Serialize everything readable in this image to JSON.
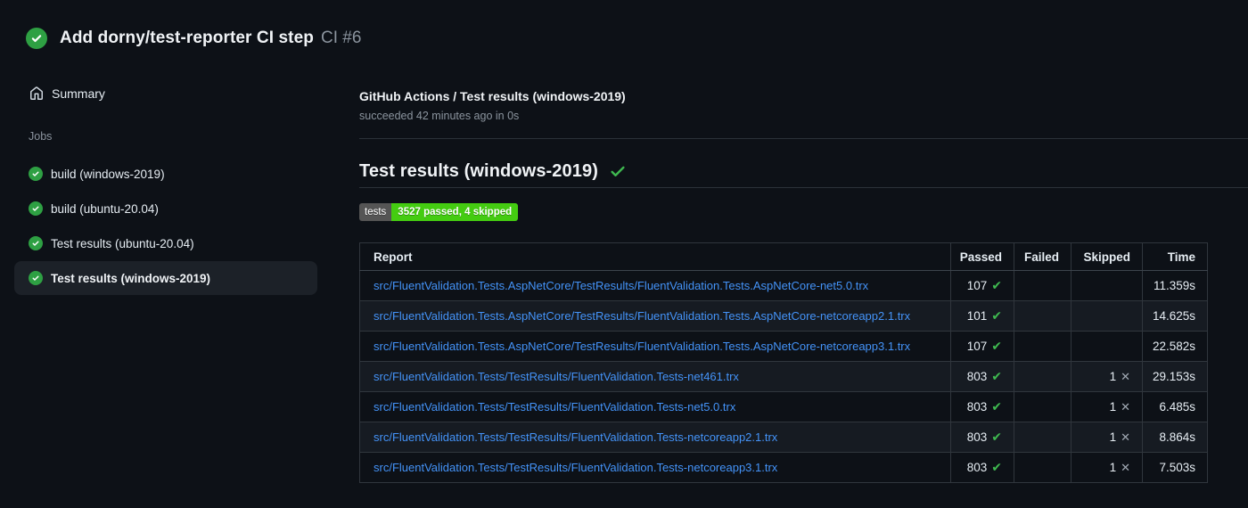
{
  "colors": {
    "page_bg": "#0d1117",
    "stripe_bg": "#161b22",
    "border": "#30363d",
    "selected_item_bg": "#1c2128",
    "link_blue": "#4493f8",
    "success_circle_green": "#2ea043",
    "check_green": "#3fb950",
    "badge_label_bg": "#555555",
    "badge_value_bg": "#44cc11",
    "muted_text": "#8b949e"
  },
  "icons": {
    "status_icon": "check-circle-green",
    "summary_icon": "home-outline",
    "heading_icon": "green-check",
    "pass_glyph": "✔",
    "skip_glyph": "✕"
  },
  "header": {
    "title": "Add dorny/test-reporter CI step",
    "run_number": "CI #6"
  },
  "sidebar": {
    "summary_label": "Summary",
    "jobs_label": "Jobs",
    "jobs": [
      {
        "label": "build (windows-2019)",
        "status": "success",
        "selected": false
      },
      {
        "label": "build (ubuntu-20.04)",
        "status": "success",
        "selected": false
      },
      {
        "label": "Test results (ubuntu-20.04)",
        "status": "success",
        "selected": false
      },
      {
        "label": "Test results (windows-2019)",
        "status": "success",
        "selected": true
      }
    ]
  },
  "main": {
    "check_title": "GitHub Actions / Test results (windows-2019)",
    "check_status": "succeeded 42 minutes ago in 0s",
    "section_title": "Test results (windows-2019)",
    "badge": {
      "label": "tests",
      "value": "3527 passed, 4 skipped"
    },
    "table": {
      "headers": [
        "Report",
        "Passed",
        "Failed",
        "Skipped",
        "Time"
      ],
      "rows": [
        {
          "report": "src/FluentValidation.Tests.AspNetCore/TestResults/FluentValidation.Tests.AspNetCore-net5.0.trx",
          "passed": "107",
          "failed": "",
          "skipped": "",
          "time": "11.359s"
        },
        {
          "report": "src/FluentValidation.Tests.AspNetCore/TestResults/FluentValidation.Tests.AspNetCore-netcoreapp2.1.trx",
          "passed": "101",
          "failed": "",
          "skipped": "",
          "time": "14.625s"
        },
        {
          "report": "src/FluentValidation.Tests.AspNetCore/TestResults/FluentValidation.Tests.AspNetCore-netcoreapp3.1.trx",
          "passed": "107",
          "failed": "",
          "skipped": "",
          "time": "22.582s"
        },
        {
          "report": "src/FluentValidation.Tests/TestResults/FluentValidation.Tests-net461.trx",
          "passed": "803",
          "failed": "",
          "skipped": "1",
          "time": "29.153s"
        },
        {
          "report": "src/FluentValidation.Tests/TestResults/FluentValidation.Tests-net5.0.trx",
          "passed": "803",
          "failed": "",
          "skipped": "1",
          "time": "6.485s"
        },
        {
          "report": "src/FluentValidation.Tests/TestResults/FluentValidation.Tests-netcoreapp2.1.trx",
          "passed": "803",
          "failed": "",
          "skipped": "1",
          "time": "8.864s"
        },
        {
          "report": "src/FluentValidation.Tests/TestResults/FluentValidation.Tests-netcoreapp3.1.trx",
          "passed": "803",
          "failed": "",
          "skipped": "1",
          "time": "7.503s"
        }
      ]
    }
  }
}
